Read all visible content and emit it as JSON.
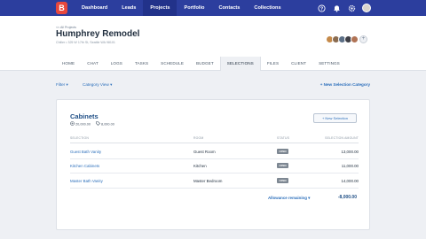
{
  "app": {
    "logo_letter": "B",
    "brand_color": "#e8483d",
    "nav_color": "#2c3e9e"
  },
  "nav": {
    "items": [
      {
        "label": "Dashboard"
      },
      {
        "label": "Leads"
      },
      {
        "label": "Projects"
      },
      {
        "label": "Portfolio"
      },
      {
        "label": "Contacts"
      },
      {
        "label": "Collections"
      }
    ],
    "active": "Projects",
    "icons": [
      "help-icon",
      "bell-icon",
      "settings-icon",
      "avatar"
    ]
  },
  "project": {
    "breadcrumb": "<< All Projects",
    "title": "Humphrey Remodel",
    "subtitle": "Chiller  •  325 W 17th St, Seattle WA 98101"
  },
  "tabs": [
    {
      "label": "HOME"
    },
    {
      "label": "CHAT"
    },
    {
      "label": "LOGS"
    },
    {
      "label": "TASKS"
    },
    {
      "label": "SCHEDULE"
    },
    {
      "label": "BUDGET"
    },
    {
      "label": "SELECTIONS"
    },
    {
      "label": "FILES"
    },
    {
      "label": "CLIENT"
    },
    {
      "label": "SETTINGS"
    }
  ],
  "filters": {
    "filter_label": "Filter ▾",
    "category_view_label": "Category View ▾",
    "new_category_label": "+ New Selection Category"
  },
  "category": {
    "title": "Cabinets",
    "allowance": "20,000.00",
    "spent": "8,000.00",
    "new_selection_label": "+ New Selection",
    "columns": {
      "selection": "SELECTION",
      "room": "ROOM",
      "status": "STATUS",
      "amount": "SELECTION AMOUNT"
    },
    "rows": [
      {
        "selection": "Guest Bath Vanity",
        "room": "Guest Room",
        "status": "OPEN",
        "amount": "13,000.00"
      },
      {
        "selection": "Kitchen Cabinets",
        "room": "Kitchen",
        "status": "OPEN",
        "amount": "11,000.00"
      },
      {
        "selection": "Master Bath Vanity",
        "room": "Master Bedroom",
        "status": "OPEN",
        "amount": "14,000.00"
      }
    ],
    "allowance_remaining_label": "Allowance remaining ▾",
    "allowance_remaining_value": "-8,000.00"
  }
}
